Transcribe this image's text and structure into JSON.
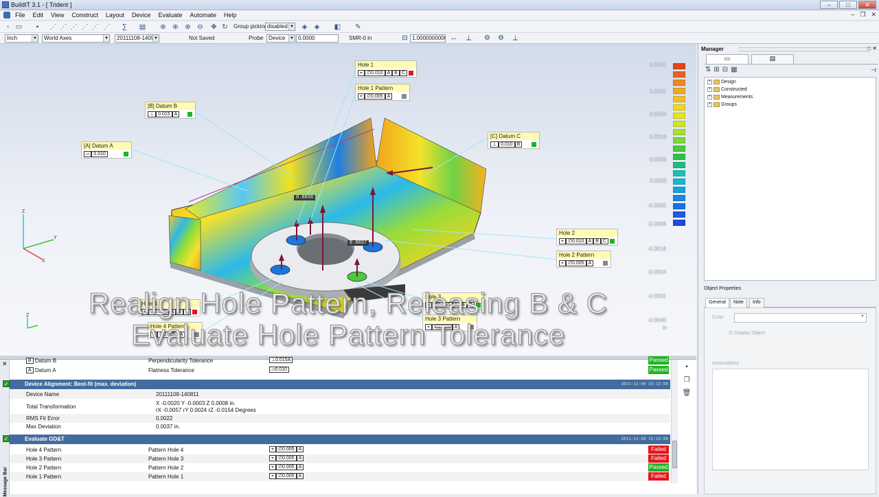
{
  "window": {
    "title": "BuildIT 3.1 - [ Trident ]",
    "min": "–",
    "max": "□",
    "close": "✕"
  },
  "menu": [
    "File",
    "Edit",
    "View",
    "Construct",
    "Layout",
    "Device",
    "Evaluate",
    "Automate",
    "Help"
  ],
  "toolbar": {
    "group_picking_label": "Group picking",
    "group_picking_value": "disabled",
    "units": "Inch",
    "axes": "World Axes",
    "alignment": "20111108-1409",
    "save_state": "Not Saved",
    "probe_label": "Probe",
    "probe_device": "Device",
    "probe_value": "0.0000",
    "smr": "SMR-0 in",
    "scale_value": "1.0000000000"
  },
  "viewport": {
    "callouts": [
      {
        "id": "hole1",
        "title": "Hole 1",
        "fcf": [
          "⌖",
          "∅0.010",
          "A",
          "B",
          "C"
        ],
        "status": "red"
      },
      {
        "id": "hole1p",
        "title": "Hole 1 Pattern",
        "fcf": [
          "⌖",
          "∅0.005",
          "A"
        ],
        "status": "gray"
      },
      {
        "id": "datumb",
        "title": "[B] Datum B",
        "fcf": [
          "⊥",
          "0.015",
          "A"
        ],
        "status": "green"
      },
      {
        "id": "datuma",
        "title": "[A] Datum A",
        "fcf": [
          "▱",
          "0.010"
        ],
        "status": "green"
      },
      {
        "id": "datumc",
        "title": "[C] Datum C",
        "fcf": [
          "⊥",
          "0.010",
          "B"
        ],
        "status": "green"
      },
      {
        "id": "hole2",
        "title": "Hole 2",
        "fcf": [
          "⌖",
          "∅0.010",
          "A",
          "B",
          "C"
        ],
        "status": "green"
      },
      {
        "id": "hole2p",
        "title": "Hole 2 Pattern",
        "fcf": [
          "⌖",
          "∅0.005",
          "A"
        ],
        "status": "gray"
      },
      {
        "id": "hole4",
        "title": "Hole 4",
        "fcf": [
          "⌖",
          "∅0.010",
          "A",
          "B",
          "C"
        ],
        "status": "red"
      },
      {
        "id": "hole4p",
        "title": "Hole 4 Pattern",
        "fcf": [
          "⌖",
          "∅0.005",
          "A"
        ],
        "status": "gray"
      },
      {
        "id": "hole3",
        "title": "Hole 3",
        "fcf": [
          "⌖",
          "∅0.010",
          "A",
          "B",
          "C"
        ],
        "status": "green"
      },
      {
        "id": "hole3p",
        "title": "Hole 3 Pattern",
        "fcf": [
          "⌖",
          "∅0.005",
          "A"
        ],
        "status": "gray"
      }
    ],
    "deviation_labels": [
      "0.0036",
      "0.0037"
    ],
    "scale_labels": [
      "0.0041",
      "0.0031",
      "0.0024",
      "0.0016",
      "0.0008",
      "0.0000",
      "-0.0002",
      "-0.0008",
      "-0.0016",
      "-0.0024",
      "-0.0031",
      "-0.0040"
    ],
    "scale_unit": "in",
    "scale_colors": [
      "#e5431a",
      "#e8641c",
      "#ec8a1e",
      "#f0a91f",
      "#f2c11e",
      "#f4d71b",
      "#e6e41e",
      "#cce628",
      "#a8e032",
      "#7fd63a",
      "#4cc93f",
      "#2cc24a",
      "#20be7c",
      "#1cc0b4",
      "#1bb4d3",
      "#1a9fe0",
      "#1b86e4",
      "#1c70e3",
      "#1d5ce0",
      "#2048d9"
    ],
    "overlay_line1": "Realign Hole Pattern, Releasing B & C",
    "overlay_line2": "Evaluate Hole Pattern Tolerance",
    "axis_labels": {
      "x": "X",
      "y": "Y",
      "z": "Z"
    }
  },
  "messages": {
    "side_label": "Message Bar",
    "prev_rows": [
      {
        "name": "Datum B",
        "type": "Perpendicularity Tolerance",
        "fcf": "⊥0.015A",
        "status": "Passed",
        "datum": "B"
      },
      {
        "name": "Datum A",
        "type": "Flatness Tolerance",
        "fcf": "▱0.010",
        "status": "Passed",
        "datum": "A"
      }
    ],
    "sec1": {
      "title": "Device Alignment: Best-fit (max. deviation)",
      "timestamp": "2011-11-08 15:12:08"
    },
    "alignment_rows": [
      {
        "label": "Device Name",
        "value": "20111108-140811"
      },
      {
        "label": "Total Transformation",
        "value": "X -0.0020 Y -0.0003 Z 0.0008 in.",
        "value2": "rX -0.0057 rY 0.0024 rZ -0.0154 Degrees"
      },
      {
        "label": "RMS Fit Error",
        "value": "0.0022"
      },
      {
        "label": "Max Deviation",
        "value": "0.0037 in."
      }
    ],
    "sec2": {
      "title": "Evaluate GD&T",
      "timestamp": "2011-11-08 15:12:08"
    },
    "gdt_rows": [
      {
        "name": "Hole 4 Pattern",
        "type": "Pattern Hole 4",
        "fcf": [
          "⌖",
          "∅0.005",
          "A"
        ],
        "status": "Failed"
      },
      {
        "name": "Hole 3 Pattern",
        "type": "Pattern Hole 3",
        "fcf": [
          "⌖",
          "∅0.005",
          "A"
        ],
        "status": "Failed"
      },
      {
        "name": "Hole 2 Pattern",
        "type": "Pattern Hole 2",
        "fcf": [
          "⌖",
          "∅0.005",
          "A"
        ],
        "status": "Passed"
      },
      {
        "name": "Hole 1 Pattern",
        "type": "Pattern Hole 1",
        "fcf": [
          "⌖",
          "∅0.005",
          "A"
        ],
        "status": "Failed"
      }
    ]
  },
  "manager": {
    "title": "Manager",
    "tree": [
      "Design",
      "Constructed",
      "Measurements",
      "Groups"
    ],
    "object_properties": "Object Properties",
    "tabs": [
      "General",
      "Note",
      "Info"
    ],
    "color_label": "Color",
    "display_object": "Display Object",
    "associations": "Associations"
  },
  "colors": {
    "passed": "#20b325",
    "failed": "#e3161d",
    "header": "#426c9d",
    "callout": "#fffab4"
  }
}
